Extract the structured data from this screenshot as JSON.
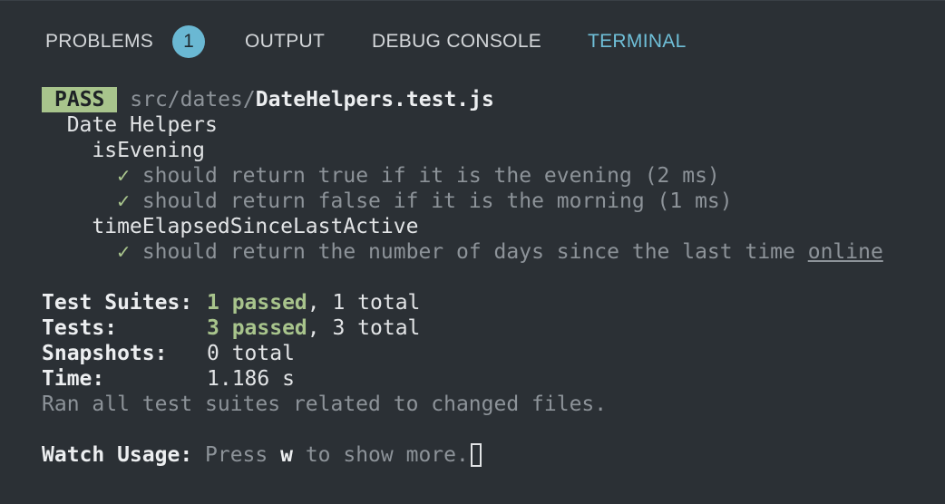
{
  "tabs": [
    {
      "label": "PROBLEMS",
      "badge": "1"
    },
    {
      "label": "OUTPUT"
    },
    {
      "label": "DEBUG CONSOLE"
    },
    {
      "label": "TERMINAL"
    }
  ],
  "active_tab": "TERMINAL",
  "terminal": {
    "pass_label": "PASS",
    "file_dir": "src/dates/",
    "file_name": "DateHelpers.test.js",
    "describe": "Date Helpers",
    "group1": "isEvening",
    "test1": "should return true if it is the evening (2 ms)",
    "test2": "should return false if it is the morning (1 ms)",
    "group2": "timeElapsedSinceLastActive",
    "test3_prefix": "should return the number of days since the last time ",
    "test3_link": "online",
    "check_glyph": "✓",
    "summary": {
      "suites_label": "Test Suites:",
      "suites_passed": "1 passed",
      "suites_total": ", 1 total",
      "tests_label": "Tests:",
      "tests_passed": "3 passed",
      "tests_total": ", 3 total",
      "snapshots_label": "Snapshots:",
      "snapshots_value": "0 total",
      "time_label": "Time:",
      "time_value": "1.186 s",
      "ran_all": "Ran all test suites related to changed files."
    },
    "watch": {
      "label": "Watch Usage:",
      "press": " Press ",
      "key": "w",
      "rest": " to show more."
    }
  },
  "colors": {
    "background": "#2b3035",
    "active_tab": "#6fbfd8",
    "badge": "#6ab8d3",
    "pass": "#a8c48c",
    "text": "#e2e4e6",
    "dim": "#8d9399"
  }
}
